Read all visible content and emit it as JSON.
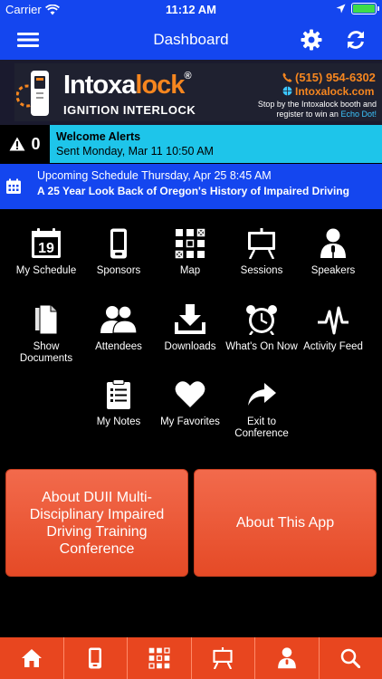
{
  "status": {
    "carrier": "Carrier",
    "time": "11:12 AM"
  },
  "nav": {
    "title": "Dashboard"
  },
  "banner": {
    "brand_main": "Intoxa",
    "brand_accent": "lock",
    "registered": "®",
    "subtitle": "IGNITION INTERLOCK",
    "phone": "(515) 954-6302",
    "website": "Intoxalock.com",
    "promo_text": "Stop by the Intoxalock booth and register to win an",
    "promo_highlight": "Echo Dot!"
  },
  "alert": {
    "count": "0",
    "title": "Welcome Alerts",
    "sent": "Sent Monday, Mar 11 10:50 AM"
  },
  "schedule": {
    "heading": "Upcoming Schedule Thursday, Apr 25 8:45 AM",
    "event": "A 25 Year Look Back of Oregon's History of Impaired Driving"
  },
  "grid": {
    "calendar_day": "19",
    "items": [
      {
        "label": "My Schedule",
        "icon": "calendar-icon"
      },
      {
        "label": "Sponsors",
        "icon": "phone-icon"
      },
      {
        "label": "Map",
        "icon": "map-grid-icon"
      },
      {
        "label": "Sessions",
        "icon": "easel-icon"
      },
      {
        "label": "Speakers",
        "icon": "speaker-icon"
      },
      {
        "label": "Show Documents",
        "icon": "documents-icon"
      },
      {
        "label": "Attendees",
        "icon": "people-icon"
      },
      {
        "label": "Downloads",
        "icon": "download-icon"
      },
      {
        "label": "What's On Now",
        "icon": "alarm-clock-icon"
      },
      {
        "label": "Activity Feed",
        "icon": "activity-icon"
      },
      {
        "label": "My Notes",
        "icon": "notes-icon"
      },
      {
        "label": "My Favorites",
        "icon": "heart-icon"
      },
      {
        "label": "Exit to Conference",
        "icon": "share-arrow-icon"
      }
    ]
  },
  "buttons": {
    "about_conference": "About DUII Multi-Disciplinary Impaired Driving Training Conference",
    "about_app": "About This App"
  },
  "tabs": [
    "home-icon",
    "phone-icon",
    "map-grid-icon",
    "easel-icon",
    "speaker-icon",
    "search-icon"
  ],
  "colors": {
    "nav_blue": "#1446ef",
    "alert_cyan": "#1ec5ea",
    "accent_orange": "#e8461f",
    "brand_orange": "#f6861f"
  }
}
